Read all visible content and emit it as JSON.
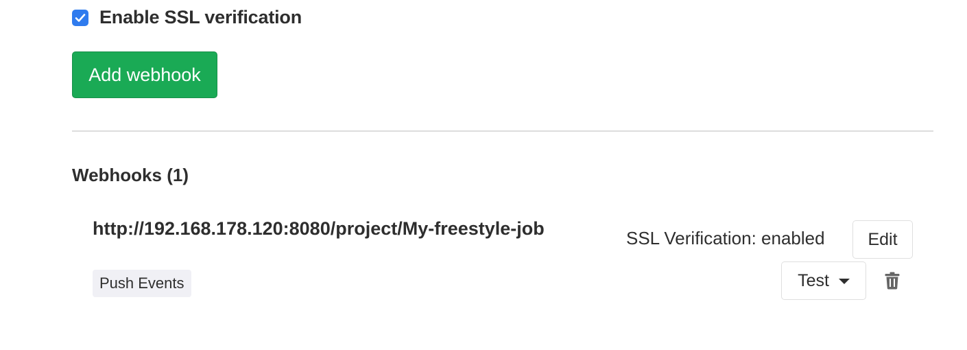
{
  "ssl": {
    "label": "Enable SSL verification",
    "checked": true,
    "checkbox_color": "#2f7bee"
  },
  "actions": {
    "add_webhook_label": "Add webhook",
    "add_webhook_color": "#1aaa55"
  },
  "webhooks": {
    "title": "Webhooks (1)",
    "items": [
      {
        "url": "http://192.168.178.120:8080/project/My-freestyle-job",
        "events": [
          "Push Events"
        ],
        "ssl_status": "SSL Verification: enabled",
        "edit_label": "Edit",
        "test_label": "Test",
        "delete_icon": "trash-icon"
      }
    ]
  }
}
